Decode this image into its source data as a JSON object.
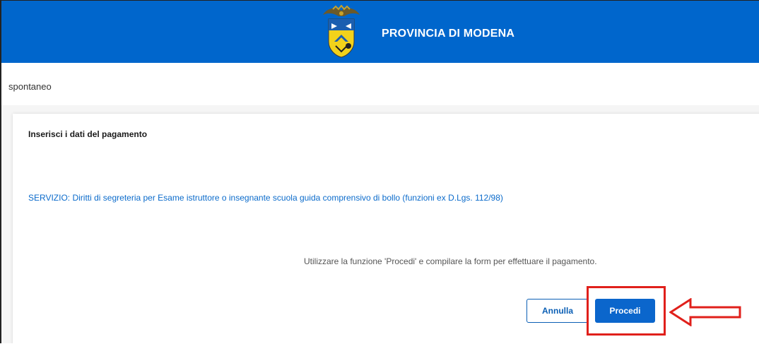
{
  "header": {
    "title": "PROVINCIA DI MODENA",
    "logo_icon": "province-coat-of-arms-icon"
  },
  "breadcrumb": {
    "text": "spontaneo"
  },
  "card": {
    "title": "Inserisci i dati del pagamento",
    "service": "SERVIZIO: Diritti di segreteria per Esame istruttore o insegnante scuola guida comprensivo di bollo (funzioni ex D.Lgs. 112/98)",
    "instruction": "Utilizzare la funzione 'Procedi' e compilare la form per effettuare il pagamento."
  },
  "buttons": {
    "cancel_label": "Annulla",
    "proceed_label": "Procedi"
  },
  "annotation": {
    "highlight_color": "#e0201b",
    "arrow_icon": "arrow-left-outline-icon"
  },
  "colors": {
    "header_bg": "#0066cc",
    "link_blue": "#0b6bcb",
    "primary_button": "#0b66cc"
  }
}
